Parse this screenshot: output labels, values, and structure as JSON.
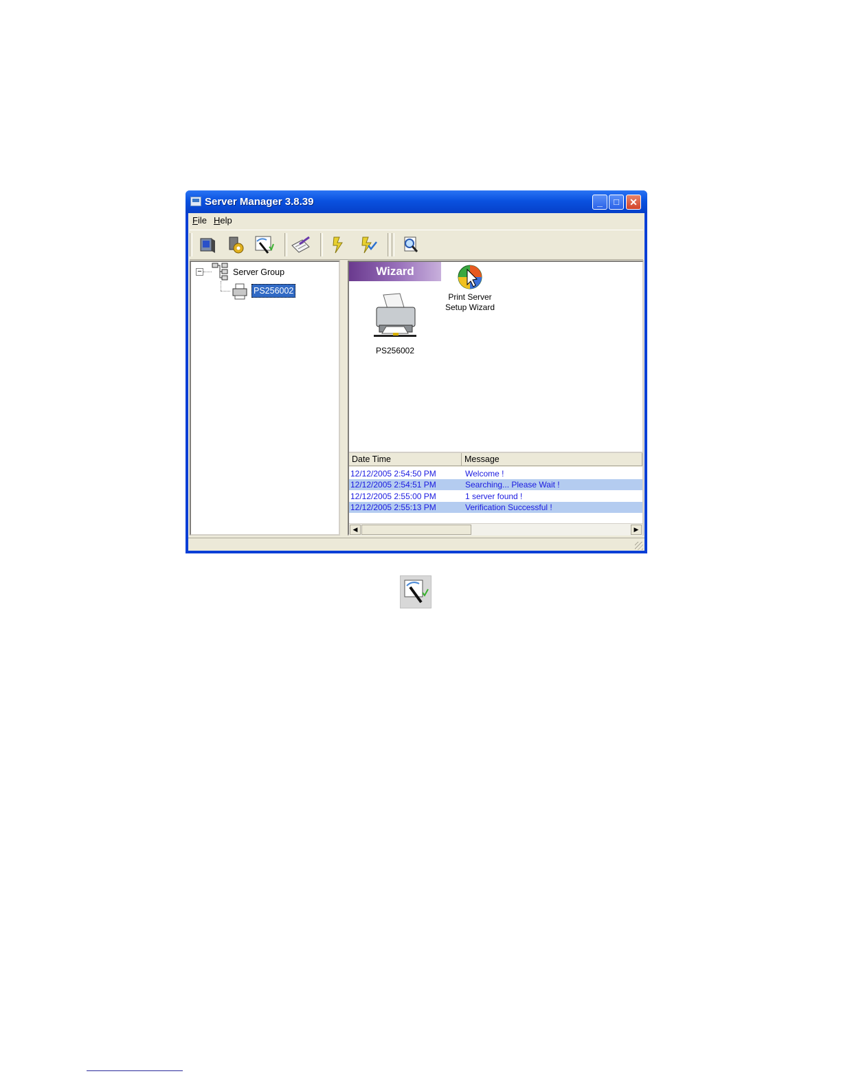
{
  "window": {
    "title": "Server Manager 3.8.39",
    "controls": {
      "minimize": "_",
      "maximize": "□",
      "close": "✕"
    }
  },
  "menu": [
    {
      "accel": "F",
      "rest": "ile"
    },
    {
      "accel": "H",
      "rest": "elp"
    }
  ],
  "toolbar": {
    "icons": [
      "server-icon",
      "settings-gear-icon",
      "setup-wizard-icon",
      "notepad-pen-icon",
      "lightning-icon",
      "lightning-check-icon",
      "search-magnifier-icon"
    ]
  },
  "tree": {
    "root": "Server Group",
    "root_toggle": "−",
    "child": "PS256002"
  },
  "right_panel": {
    "banner": "Wizard",
    "device_label": "PS256002",
    "wizard_label_line1": "Print Server",
    "wizard_label_line2": "Setup Wizard"
  },
  "log": {
    "columns": [
      "Date Time",
      "Message"
    ],
    "rows": [
      {
        "datetime": "12/12/2005 2:54:50 PM",
        "message": "Welcome !"
      },
      {
        "datetime": "12/12/2005 2:54:51 PM",
        "message": "Searching... Please Wait !"
      },
      {
        "datetime": "12/12/2005 2:55:00 PM",
        "message": "1 server found !"
      },
      {
        "datetime": "12/12/2005 2:55:13 PM",
        "message": "Verification Successful !"
      }
    ],
    "scroll_left": "◀",
    "scroll_right": "▶"
  },
  "colors": {
    "titlebar": "#0a52e0",
    "log_text": "#1a1ae0",
    "row_highlight": "#b4ccf0",
    "selection": "#316ac5",
    "banner": "#7a4a9e"
  }
}
